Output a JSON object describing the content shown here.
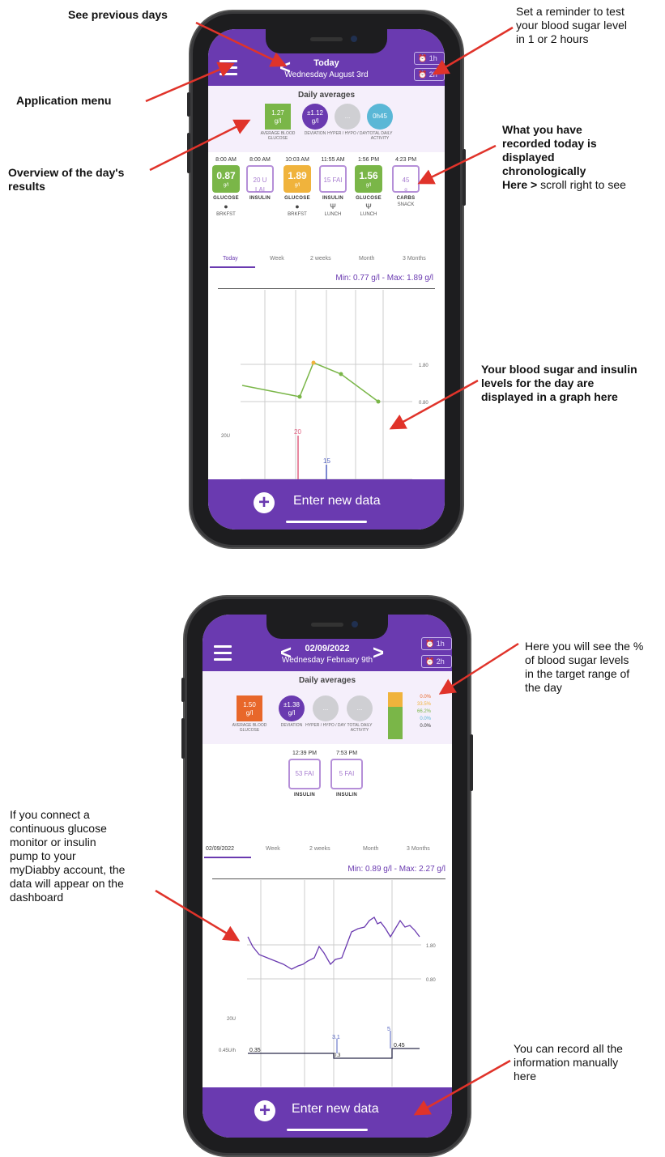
{
  "annotations": {
    "previous_days": "See previous days",
    "reminder": [
      "Set a reminder to test",
      "your blood sugar level",
      "in 1 or 2 hours"
    ],
    "app_menu": "Application menu",
    "overview": [
      "Overview of the day's",
      "results"
    ],
    "recorded": [
      "What you have",
      "recorded today is",
      "displayed",
      "chronologically"
    ],
    "scroll_prefix": "Here >",
    "scroll_suffix": "scroll right to see",
    "graph": [
      "Your blood sugar and insulin",
      "levels for the day are",
      "displayed in a graph here"
    ],
    "target_range": [
      "Here you will see the %",
      "of blood sugar levels",
      "in the target range of",
      "the day"
    ],
    "cgm": [
      "If you connect a",
      "continuous glucose",
      "monitor or insulin",
      "pump to your",
      "myDiabby account, the",
      "data will appear on the",
      "dashboard"
    ],
    "manual": [
      "You can record all the",
      "information manually",
      "here"
    ]
  },
  "colors": {
    "purple": "#6a3ab0",
    "green": "#7ab648",
    "orange": "#f0b33c",
    "red_orange": "#e8672a",
    "teal": "#5ab7d6",
    "grey": "#cfcfd3",
    "arrow": "#e0332a"
  },
  "phone1": {
    "header": {
      "title": "Today",
      "date": "Wednesday August 3rd",
      "alarm1": "1h",
      "alarm2": "2h"
    },
    "averages": {
      "title": "Daily averages",
      "avg_value": "1.27",
      "avg_unit": "g/l",
      "avg_label": "AVERAGE BLOOD GLUCOSE",
      "dev_value": "±1.12",
      "dev_unit": "g/l",
      "dev_label": "DEVIATION",
      "hyper_value": "...",
      "hyper_label": "HYPER / HYPO / DAY",
      "activity_value": "0h45",
      "activity_label": "TOTAL DAILY ACTIVITY"
    },
    "entries": [
      {
        "time": "8:00 AM",
        "value": "0.87",
        "unit": "g/l",
        "label": "GLUCOSE",
        "sub": "BRKFST"
      },
      {
        "time": "8:00 AM",
        "value": "20 U LAI",
        "unit": "",
        "label": "INSULIN",
        "sub": ""
      },
      {
        "time": "10:03 AM",
        "value": "1.89",
        "unit": "g/l",
        "label": "GLUCOSE",
        "sub": "BRKFST"
      },
      {
        "time": "11:55 AM",
        "value": "15 FAI",
        "unit": "",
        "label": "INSULIN",
        "sub": "LUNCH"
      },
      {
        "time": "1:56 PM",
        "value": "1.56",
        "unit": "g/l",
        "label": "GLUCOSE",
        "sub": "LUNCH"
      },
      {
        "time": "4:23 PM",
        "value": "45",
        "unit": "g",
        "label": "CARBS",
        "sub": "SNACK"
      }
    ],
    "tabs": [
      "Today",
      "Week",
      "2 weeks",
      "Month",
      "3 Months"
    ],
    "minmax": "Min: 0.77 g/l - Max: 1.89 g/l",
    "graph": {
      "y_high": "1.80",
      "y_low": "0.80",
      "insulin_scale": "20U",
      "bolus1": "20",
      "bolus2": "15"
    },
    "enter_label": "Enter new data"
  },
  "phone2": {
    "header": {
      "title": "02/09/2022",
      "date": "Wednesday February 9th",
      "alarm1": "1h",
      "alarm2": "2h"
    },
    "averages": {
      "title": "Daily averages",
      "avg_value": "1.50",
      "avg_unit": "g/l",
      "avg_label": "AVERAGE BLOOD GLUCOSE",
      "dev_value": "±1.38",
      "dev_unit": "g/l",
      "dev_label": "DEVIATION",
      "hyper_value": "...",
      "hyper_label": "HYPER / HYPO / DAY",
      "activity_value": "...",
      "activity_label": "TOTAL DAILY ACTIVITY",
      "target_pct": [
        "0.0%",
        "33.5%",
        "66.2%",
        "0.0%",
        "0.0%"
      ]
    },
    "entries": [
      {
        "time": "12:39 PM",
        "value": "53 FAI",
        "label": "INSULIN"
      },
      {
        "time": "7:53 PM",
        "value": "5 FAI",
        "label": "INSULIN"
      }
    ],
    "tabs": [
      "02/09/2022",
      "Week",
      "2 weeks",
      "Month",
      "3 Months"
    ],
    "minmax": "Min: 0.89 g/l - Max: 2.27 g/l",
    "graph": {
      "y_high": "1.80",
      "y_low": "0.80",
      "insulin_scale": "20U",
      "basal_label": "0.45U/h",
      "b1": "0.35",
      "b2": "3.1",
      "b3": "0.3",
      "b4": "5",
      "b5": "0.45"
    },
    "enter_label": "Enter new data"
  }
}
